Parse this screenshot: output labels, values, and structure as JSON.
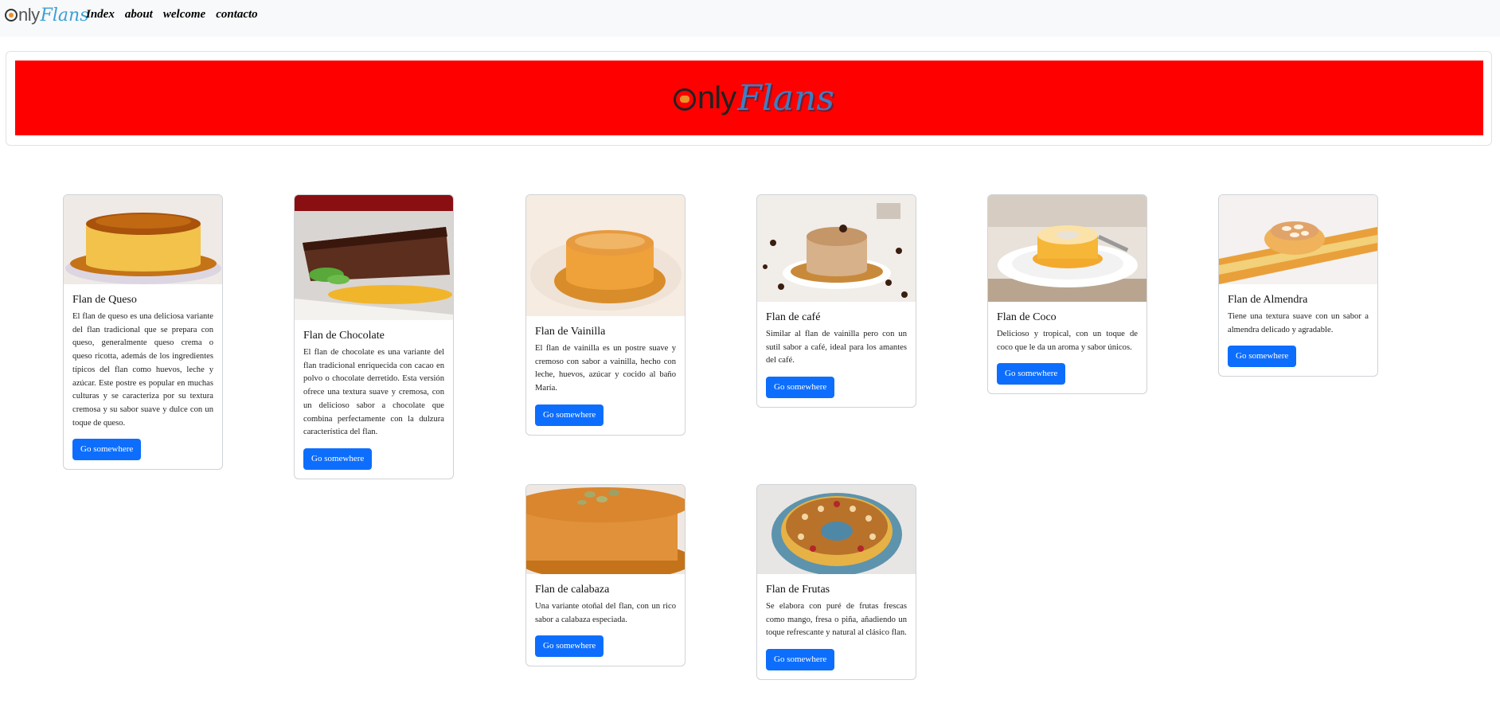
{
  "nav": {
    "brand_only": "nly",
    "brand_flans": "Flans",
    "links": [
      "Index",
      "about",
      "welcome",
      "contacto"
    ]
  },
  "hero": {
    "logo_only": "nly",
    "logo_flans": "Flans",
    "background": "#ff0000"
  },
  "accent": "#0d6efd",
  "cards": [
    {
      "title": "Flan de Queso",
      "text": "El flan de queso es una deliciosa variante del flan tradicional que se prepara con queso, generalmente queso crema o queso ricotta, además de los ingredientes típicos del flan como huevos, leche y azúcar. Este postre es popular en muchas culturas y se caracteriza por su textura cremosa y su sabor suave y dulce con un toque de queso.",
      "button": "Go somewhere",
      "image": "cheese-flan-photo"
    },
    {
      "title": "Flan de Chocolate",
      "text": "El flan de chocolate es una variante del flan tradicional enriquecida con cacao en polvo o chocolate derretido. Esta versión ofrece una textura suave y cremosa, con un delicioso sabor a chocolate que combina perfectamente con la dulzura característica del flan.",
      "button": "Go somewhere",
      "image": "chocolate-flan-photo"
    },
    {
      "title": "Flan de Vainilla",
      "text": "El flan de vainilla es un postre suave y cremoso con sabor a vainilla, hecho con leche, huevos, azúcar y cocido al baño María.",
      "button": "Go somewhere",
      "image": "vanilla-flan-photo"
    },
    {
      "title": "Flan de café",
      "text": "Similar al flan de vainilla pero con un sutil sabor a café, ideal para los amantes del café.",
      "button": "Go somewhere",
      "image": "coffee-flan-photo"
    },
    {
      "title": "Flan de Coco",
      "text": "Delicioso y tropical, con un toque de coco que le da un aroma y sabor únicos.",
      "button": "Go somewhere",
      "image": "coconut-flan-photo"
    },
    {
      "title": "Flan de Almendra",
      "text": "Tiene una textura suave con un sabor a almendra delicado y agradable.",
      "button": "Go somewhere",
      "image": "almond-flan-photo"
    },
    {
      "title": "Flan de calabaza",
      "text": "Una variante otoñal del flan, con un rico sabor a calabaza especiada.",
      "button": "Go somewhere",
      "image": "pumpkin-flan-photo"
    },
    {
      "title": "Flan de Frutas",
      "text": "Se elabora con puré de frutas frescas como mango, fresa o piña, añadiendo un toque refrescante y natural al clásico flan.",
      "button": "Go somewhere",
      "image": "fruit-flan-photo"
    }
  ]
}
